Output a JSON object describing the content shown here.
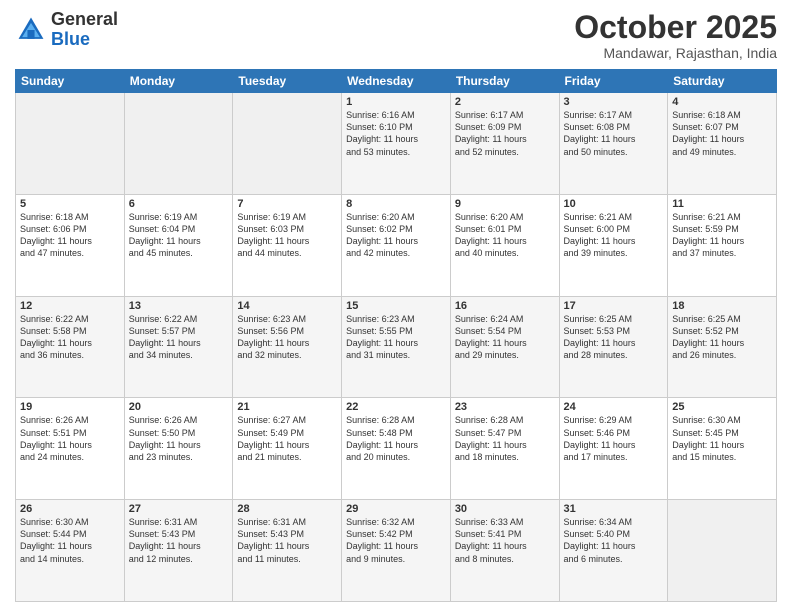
{
  "header": {
    "logo_general": "General",
    "logo_blue": "Blue",
    "month_title": "October 2025",
    "location": "Mandawar, Rajasthan, India"
  },
  "days_of_week": [
    "Sunday",
    "Monday",
    "Tuesday",
    "Wednesday",
    "Thursday",
    "Friday",
    "Saturday"
  ],
  "weeks": [
    [
      {
        "day": "",
        "info": ""
      },
      {
        "day": "",
        "info": ""
      },
      {
        "day": "",
        "info": ""
      },
      {
        "day": "1",
        "info": "Sunrise: 6:16 AM\nSunset: 6:10 PM\nDaylight: 11 hours\nand 53 minutes."
      },
      {
        "day": "2",
        "info": "Sunrise: 6:17 AM\nSunset: 6:09 PM\nDaylight: 11 hours\nand 52 minutes."
      },
      {
        "day": "3",
        "info": "Sunrise: 6:17 AM\nSunset: 6:08 PM\nDaylight: 11 hours\nand 50 minutes."
      },
      {
        "day": "4",
        "info": "Sunrise: 6:18 AM\nSunset: 6:07 PM\nDaylight: 11 hours\nand 49 minutes."
      }
    ],
    [
      {
        "day": "5",
        "info": "Sunrise: 6:18 AM\nSunset: 6:06 PM\nDaylight: 11 hours\nand 47 minutes."
      },
      {
        "day": "6",
        "info": "Sunrise: 6:19 AM\nSunset: 6:04 PM\nDaylight: 11 hours\nand 45 minutes."
      },
      {
        "day": "7",
        "info": "Sunrise: 6:19 AM\nSunset: 6:03 PM\nDaylight: 11 hours\nand 44 minutes."
      },
      {
        "day": "8",
        "info": "Sunrise: 6:20 AM\nSunset: 6:02 PM\nDaylight: 11 hours\nand 42 minutes."
      },
      {
        "day": "9",
        "info": "Sunrise: 6:20 AM\nSunset: 6:01 PM\nDaylight: 11 hours\nand 40 minutes."
      },
      {
        "day": "10",
        "info": "Sunrise: 6:21 AM\nSunset: 6:00 PM\nDaylight: 11 hours\nand 39 minutes."
      },
      {
        "day": "11",
        "info": "Sunrise: 6:21 AM\nSunset: 5:59 PM\nDaylight: 11 hours\nand 37 minutes."
      }
    ],
    [
      {
        "day": "12",
        "info": "Sunrise: 6:22 AM\nSunset: 5:58 PM\nDaylight: 11 hours\nand 36 minutes."
      },
      {
        "day": "13",
        "info": "Sunrise: 6:22 AM\nSunset: 5:57 PM\nDaylight: 11 hours\nand 34 minutes."
      },
      {
        "day": "14",
        "info": "Sunrise: 6:23 AM\nSunset: 5:56 PM\nDaylight: 11 hours\nand 32 minutes."
      },
      {
        "day": "15",
        "info": "Sunrise: 6:23 AM\nSunset: 5:55 PM\nDaylight: 11 hours\nand 31 minutes."
      },
      {
        "day": "16",
        "info": "Sunrise: 6:24 AM\nSunset: 5:54 PM\nDaylight: 11 hours\nand 29 minutes."
      },
      {
        "day": "17",
        "info": "Sunrise: 6:25 AM\nSunset: 5:53 PM\nDaylight: 11 hours\nand 28 minutes."
      },
      {
        "day": "18",
        "info": "Sunrise: 6:25 AM\nSunset: 5:52 PM\nDaylight: 11 hours\nand 26 minutes."
      }
    ],
    [
      {
        "day": "19",
        "info": "Sunrise: 6:26 AM\nSunset: 5:51 PM\nDaylight: 11 hours\nand 24 minutes."
      },
      {
        "day": "20",
        "info": "Sunrise: 6:26 AM\nSunset: 5:50 PM\nDaylight: 11 hours\nand 23 minutes."
      },
      {
        "day": "21",
        "info": "Sunrise: 6:27 AM\nSunset: 5:49 PM\nDaylight: 11 hours\nand 21 minutes."
      },
      {
        "day": "22",
        "info": "Sunrise: 6:28 AM\nSunset: 5:48 PM\nDaylight: 11 hours\nand 20 minutes."
      },
      {
        "day": "23",
        "info": "Sunrise: 6:28 AM\nSunset: 5:47 PM\nDaylight: 11 hours\nand 18 minutes."
      },
      {
        "day": "24",
        "info": "Sunrise: 6:29 AM\nSunset: 5:46 PM\nDaylight: 11 hours\nand 17 minutes."
      },
      {
        "day": "25",
        "info": "Sunrise: 6:30 AM\nSunset: 5:45 PM\nDaylight: 11 hours\nand 15 minutes."
      }
    ],
    [
      {
        "day": "26",
        "info": "Sunrise: 6:30 AM\nSunset: 5:44 PM\nDaylight: 11 hours\nand 14 minutes."
      },
      {
        "day": "27",
        "info": "Sunrise: 6:31 AM\nSunset: 5:43 PM\nDaylight: 11 hours\nand 12 minutes."
      },
      {
        "day": "28",
        "info": "Sunrise: 6:31 AM\nSunset: 5:43 PM\nDaylight: 11 hours\nand 11 minutes."
      },
      {
        "day": "29",
        "info": "Sunrise: 6:32 AM\nSunset: 5:42 PM\nDaylight: 11 hours\nand 9 minutes."
      },
      {
        "day": "30",
        "info": "Sunrise: 6:33 AM\nSunset: 5:41 PM\nDaylight: 11 hours\nand 8 minutes."
      },
      {
        "day": "31",
        "info": "Sunrise: 6:34 AM\nSunset: 5:40 PM\nDaylight: 11 hours\nand 6 minutes."
      },
      {
        "day": "",
        "info": ""
      }
    ]
  ]
}
